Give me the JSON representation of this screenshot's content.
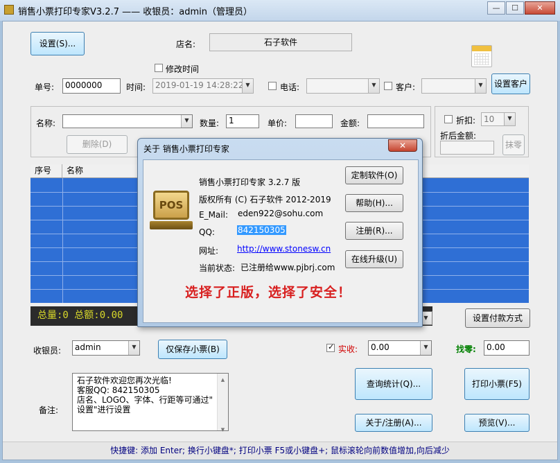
{
  "window": {
    "title": "销售小票打印专家V3.2.7 —— 收银员：admin（管理员）",
    "min_label": "—",
    "max_label": "☐",
    "close_label": "✕"
  },
  "top": {
    "settings_button": "设置(S)...",
    "store_label": "店名:",
    "store_name": "石子软件",
    "modify_time_label": "修改时间",
    "order_no_label": "单号:",
    "order_no": "0000000",
    "time_label": "时间:",
    "time_value": "2019-01-19 14:28:22",
    "phone_label": "电话:",
    "customer_label": "客户:",
    "set_customer_button": "设置客户"
  },
  "item": {
    "name_label": "名称:",
    "qty_label": "数量:",
    "qty_value": "1",
    "price_label": "单价:",
    "amount_label": "金额:",
    "delete_button": "删除(D)",
    "discount_label": "折扣:",
    "discount_value": "10",
    "after_discount_label": "折后金额:",
    "round_button": "抹零"
  },
  "grid": {
    "headers": [
      "序号",
      "名称"
    ]
  },
  "summary": {
    "text": "总量:0  总额:0.00"
  },
  "payment": {
    "set_payment_button": "设置付款方式",
    "cashier_label": "收银员:",
    "cashier_value": "admin",
    "save_only_button": "仅保存小票(B)",
    "received_label": "实收:",
    "received_value": "0.00",
    "change_label": "找零:",
    "change_value": "0.00"
  },
  "notes": {
    "label": "备注:",
    "lines": [
      "石子软件欢迎您再次光临!",
      "客服QQ: 842150305",
      "店名、LOGO、字体、行距等可通过\"",
      "设置\"进行设置"
    ]
  },
  "actions": {
    "query_stats": "查询统计(Q)...",
    "print_receipt": "打印小票(F5)",
    "about_register": "关于/注册(A)...",
    "preview": "预览(V)..."
  },
  "footer": {
    "shortcuts": "快捷键:  添加 Enter; 换行小键盘*; 打印小票 F5或小键盘+; 鼠标滚轮向前数值增加,向后减少"
  },
  "about_dialog": {
    "title": "关于 销售小票打印专家",
    "close_label": "✕",
    "logo_text": "POS",
    "product": "销售小票打印专家 3.2.7 版",
    "copyright": "版权所有 (C) 石子软件 2012-2019",
    "email_label": "E_Mail:",
    "email": "eden922@sohu.com",
    "qq_label": "QQ:",
    "qq": "842150305",
    "site_label": "网址:",
    "site": "http://www.stonesw.cn",
    "status_label": "当前状态:",
    "status": "已注册给www.pjbrj.com",
    "buttons": {
      "custom": "定制软件(O)",
      "help": "帮助(H)...",
      "register": "注册(R)...",
      "upgrade": "在线升级(U)"
    },
    "slogan": "选择了正版，选择了安全！"
  },
  "colors": {
    "grid_selection": "#2f6fd5",
    "slogan": "#d81f1f",
    "summary_text": "#d9d92a",
    "received_label": "#d00000",
    "change_label": "#008000"
  }
}
